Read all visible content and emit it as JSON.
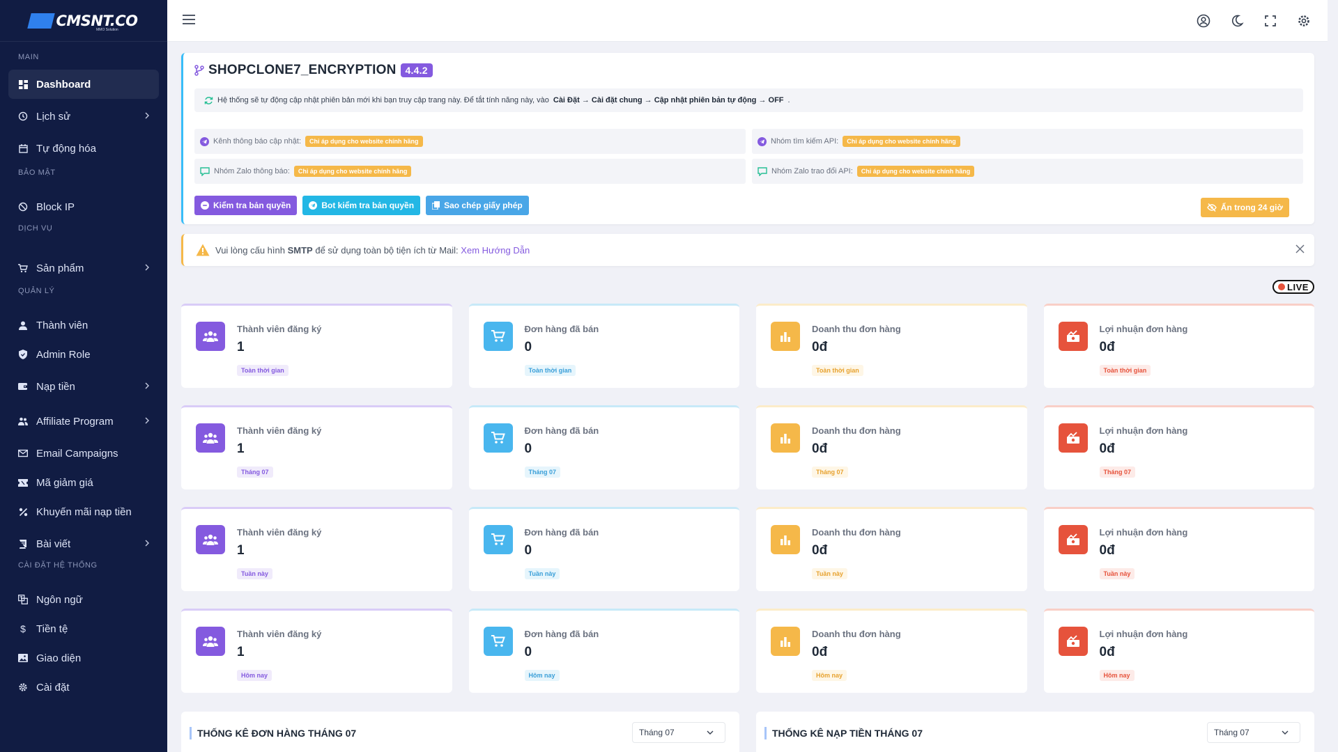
{
  "brand": {
    "logo_text": "CMSNT.CO",
    "logo_sub": "MMO Solution"
  },
  "sidebar": {
    "categories": {
      "main": "MAIN",
      "security": "BẢO MẬT",
      "service": "DỊCH VỤ",
      "manage": "QUẢN LÝ",
      "system": "CÀI ĐẶT HỆ THỐNG"
    },
    "items": {
      "dashboard": "Dashboard",
      "history": "Lịch sử",
      "automation": "Tự động hóa",
      "block_ip": "Block IP",
      "products": "Sản phẩm",
      "members": "Thành viên",
      "admin_role": "Admin Role",
      "deposit": "Nạp tiền",
      "affiliate": "Affiliate Program",
      "email": "Email Campaigns",
      "coupon": "Mã giảm giá",
      "promo": "Khuyến mãi nạp tiền",
      "posts": "Bài viết",
      "language": "Ngôn ngữ",
      "currency": "Tiền tệ",
      "theme": "Giao diện",
      "settings": "Cài đặt"
    }
  },
  "license": {
    "title": "SHOPCLONE7_ENCRYPTION",
    "version": "4.4.2",
    "notice_pre": "Hệ thống sẽ tự động cập nhật phiên bản mới khi bạn truy cập trang này. Để tắt tính năng này, vào",
    "notice_path": "Cài Đặt → Cài đặt chung → Cập nhật phiên bản tự động → OFF",
    "links": [
      {
        "label": "Kênh thông báo cập nhật:",
        "tag": "Chỉ áp dụng cho website chính hãng"
      },
      {
        "label": "Nhóm tìm kiếm API:",
        "tag": "Chỉ áp dụng cho website chính hãng"
      },
      {
        "label": "Nhóm Zalo thông báo:",
        "tag": "Chỉ áp dụng cho website chính hãng"
      },
      {
        "label": "Nhóm Zalo trao đổi API:",
        "tag": "Chỉ áp dụng cho website chính hãng"
      }
    ],
    "buttons": {
      "check": "Kiểm tra bản quyền",
      "bot": "Bot kiểm tra bản quyền",
      "copy": "Sao chép giấy phép",
      "hide": "Ẩn trong 24 giờ"
    }
  },
  "smtp_warning": {
    "pre": "Vui lòng cấu hình",
    "bold": "SMTP",
    "post": "để sử dụng toàn bộ tiện ích từ Mail:",
    "link": "Xem Hướng Dẫn"
  },
  "live_label": "LIVE",
  "stats": {
    "labels": [
      "Thành viên đăng ký",
      "Đơn hàng đã bán",
      "Doanh thu đơn hàng",
      "Lợi nhuận đơn hàng"
    ],
    "rows": [
      {
        "period": "Toàn thời gian",
        "values": [
          "1",
          "0",
          "0đ",
          "0đ"
        ]
      },
      {
        "period": "Tháng 07",
        "values": [
          "1",
          "0",
          "0đ",
          "0đ"
        ]
      },
      {
        "period": "Tuần này",
        "values": [
          "1",
          "0",
          "0đ",
          "0đ"
        ]
      },
      {
        "period": "Hôm nay",
        "values": [
          "1",
          "0",
          "0đ",
          "0đ"
        ]
      }
    ]
  },
  "bottom": {
    "orders_title": "THỐNG KÊ ĐƠN HÀNG THÁNG 07",
    "deposit_title": "THỐNG KÊ NẠP TIỀN THÁNG 07",
    "month_select": "Tháng 07"
  },
  "colors": {
    "sidebar": "#111c43",
    "primary": "#845adf",
    "info": "#49b6ee",
    "warning": "#f5b849",
    "danger": "#e6533c"
  }
}
